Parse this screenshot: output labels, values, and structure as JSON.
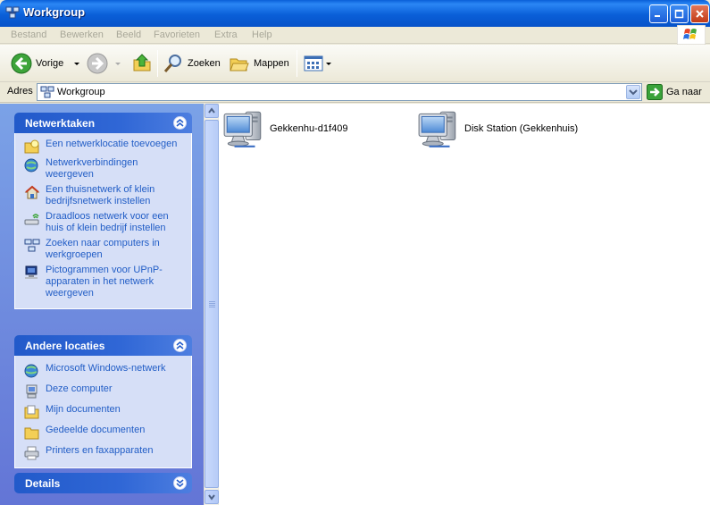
{
  "window": {
    "title": "Workgroup"
  },
  "menubar": {
    "items": [
      "Bestand",
      "Bewerken",
      "Beeld",
      "Favorieten",
      "Extra",
      "Help"
    ]
  },
  "toolbar": {
    "back_label": "Vorige",
    "search_label": "Zoeken",
    "folders_label": "Mappen"
  },
  "address": {
    "label": "Adres",
    "value": "Workgroup",
    "go_label": "Ga naar"
  },
  "taskpane": {
    "network_tasks": {
      "header": "Netwerktaken",
      "items": [
        {
          "label": "Een netwerklocatie toevoegen",
          "icon": "add-network-place-icon"
        },
        {
          "label": "Netwerkverbindingen weergeven",
          "icon": "network-connections-icon"
        },
        {
          "label": "Een thuisnetwerk of klein bedrijfsnetwerk instellen",
          "icon": "home-network-icon"
        },
        {
          "label": "Draadloos netwerk voor een huis of klein bedrijf instellen",
          "icon": "wireless-network-icon"
        },
        {
          "label": "Zoeken naar computers in werkgroepen",
          "icon": "workgroup-computers-icon"
        },
        {
          "label": "Pictogrammen voor UPnP-apparaten in het netwerk weergeven",
          "icon": "upnp-devices-icon"
        }
      ]
    },
    "other_places": {
      "header": "Andere locaties",
      "items": [
        {
          "label": "Microsoft Windows-netwerk",
          "icon": "windows-network-icon"
        },
        {
          "label": "Deze computer",
          "icon": "my-computer-icon"
        },
        {
          "label": "Mijn documenten",
          "icon": "my-documents-icon"
        },
        {
          "label": "Gedeelde documenten",
          "icon": "shared-documents-icon"
        },
        {
          "label": "Printers en faxapparaten",
          "icon": "printers-faxes-icon"
        }
      ]
    },
    "details": {
      "header": "Details"
    }
  },
  "content": {
    "items": [
      {
        "label": "Gekkenhu-d1f409",
        "icon": "networked-computer-icon"
      },
      {
        "label": "Disk Station (Gekkenhuis)",
        "icon": "networked-computer-icon"
      }
    ]
  },
  "colors": {
    "titlebar": "#0a5fd8",
    "task_link": "#215dc6",
    "panel_header": "#225aca",
    "panel_body": "#d6dff7",
    "pane_background": "#7ba2e7"
  }
}
